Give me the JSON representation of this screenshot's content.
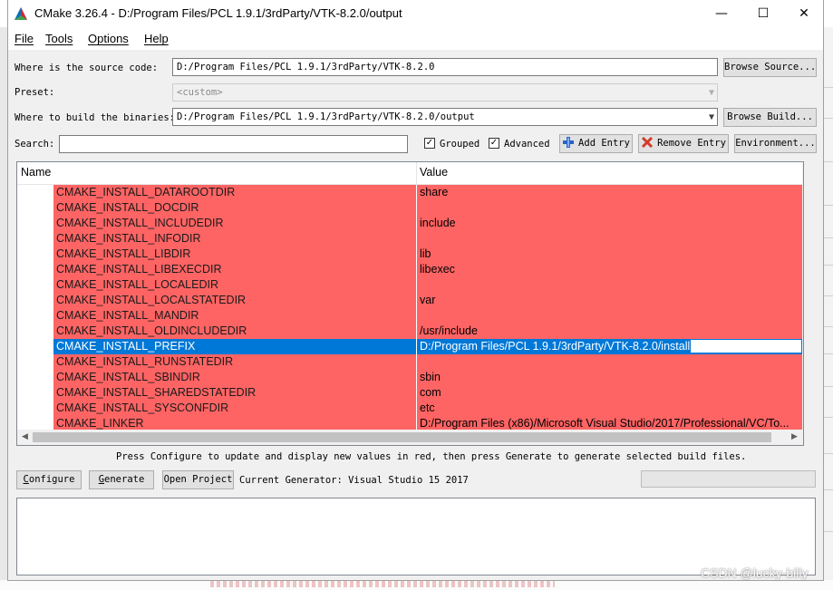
{
  "window": {
    "title": "CMake 3.26.4 - D:/Program Files/PCL 1.9.1/3rdParty/VTK-8.2.0/output",
    "minimize_glyph": "—",
    "maximize_glyph": "☐",
    "close_glyph": "✕"
  },
  "menu": [
    {
      "label": "File"
    },
    {
      "label": "Tools"
    },
    {
      "label": "Options"
    },
    {
      "label": "Help"
    }
  ],
  "source": {
    "label": "Where is the source code:",
    "value": "D:/Program Files/PCL 1.9.1/3rdParty/VTK-8.2.0",
    "browse_label": "Browse Source..."
  },
  "preset": {
    "label": "Preset:",
    "value": "<custom>"
  },
  "build": {
    "label": "Where to build the binaries:",
    "value": "D:/Program Files/PCL 1.9.1/3rdParty/VTK-8.2.0/output",
    "browse_label": "Browse Build..."
  },
  "search": {
    "label": "Search:",
    "value": ""
  },
  "options": {
    "grouped_label": "Grouped",
    "grouped_checked": true,
    "advanced_label": "Advanced",
    "advanced_checked": true,
    "add_entry_label": "Add Entry",
    "remove_entry_label": "Remove Entry",
    "environment_label": "Environment..."
  },
  "table": {
    "columns": [
      "Name",
      "Value"
    ],
    "row_color": "#ff6464",
    "selected_color": "#0078d7",
    "rows": [
      {
        "name": "CMAKE_INSTALL_DATAROOTDIR",
        "value": "share"
      },
      {
        "name": "CMAKE_INSTALL_DOCDIR",
        "value": ""
      },
      {
        "name": "CMAKE_INSTALL_INCLUDEDIR",
        "value": "include"
      },
      {
        "name": "CMAKE_INSTALL_INFODIR",
        "value": ""
      },
      {
        "name": "CMAKE_INSTALL_LIBDIR",
        "value": "lib"
      },
      {
        "name": "CMAKE_INSTALL_LIBEXECDIR",
        "value": "libexec"
      },
      {
        "name": "CMAKE_INSTALL_LOCALEDIR",
        "value": ""
      },
      {
        "name": "CMAKE_INSTALL_LOCALSTATEDIR",
        "value": "var"
      },
      {
        "name": "CMAKE_INSTALL_MANDIR",
        "value": ""
      },
      {
        "name": "CMAKE_INSTALL_OLDINCLUDEDIR",
        "value": "/usr/include"
      },
      {
        "name": "CMAKE_INSTALL_PREFIX",
        "value": "D:/Program Files/PCL 1.9.1/3rdParty/VTK-8.2.0/install",
        "selected": true,
        "editing": true
      },
      {
        "name": "CMAKE_INSTALL_RUNSTATEDIR",
        "value": ""
      },
      {
        "name": "CMAKE_INSTALL_SBINDIR",
        "value": "sbin"
      },
      {
        "name": "CMAKE_INSTALL_SHAREDSTATEDIR",
        "value": "com"
      },
      {
        "name": "CMAKE_INSTALL_SYSCONFDIR",
        "value": "etc"
      },
      {
        "name": "CMAKE_LINKER",
        "value": "D:/Program Files (x86)/Microsoft Visual Studio/2017/Professional/VC/To..."
      }
    ]
  },
  "hint": "Press Configure to update and display new values in red, then press Generate to generate selected build files.",
  "actions": {
    "configure_label": "Configure",
    "generate_label": "Generate",
    "open_project_label": "Open Project",
    "generator_text": "Current Generator: Visual Studio 15 2017"
  },
  "progress": 0,
  "output_text": "",
  "watermark": "CSDN @lucky-billy"
}
